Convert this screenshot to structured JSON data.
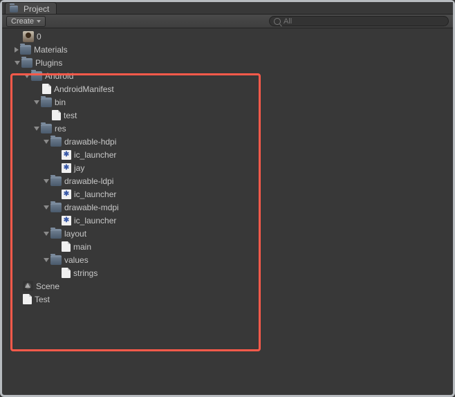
{
  "tab": {
    "title": "Project"
  },
  "toolbar": {
    "create_label": "Create",
    "search_placeholder": "All"
  },
  "tree": [
    {
      "depth": 0,
      "arrow": "none",
      "icon": "avatar",
      "label": "0"
    },
    {
      "depth": 0,
      "arrow": "collapsed",
      "icon": "folder",
      "label": "Materials"
    },
    {
      "depth": 0,
      "arrow": "expanded",
      "icon": "folder",
      "label": "Plugins"
    },
    {
      "depth": 1,
      "arrow": "expanded",
      "icon": "folder",
      "label": "Android"
    },
    {
      "depth": 2,
      "arrow": "none",
      "icon": "file",
      "label": "AndroidManifest"
    },
    {
      "depth": 2,
      "arrow": "expanded",
      "icon": "folder",
      "label": "bin"
    },
    {
      "depth": 3,
      "arrow": "none",
      "icon": "file",
      "label": "test"
    },
    {
      "depth": 2,
      "arrow": "expanded",
      "icon": "folder",
      "label": "res"
    },
    {
      "depth": 3,
      "arrow": "expanded",
      "icon": "folder",
      "label": "drawable-hdpi"
    },
    {
      "depth": 4,
      "arrow": "none",
      "icon": "img",
      "label": "ic_launcher"
    },
    {
      "depth": 4,
      "arrow": "none",
      "icon": "img",
      "label": "jay"
    },
    {
      "depth": 3,
      "arrow": "expanded",
      "icon": "folder",
      "label": "drawable-ldpi"
    },
    {
      "depth": 4,
      "arrow": "none",
      "icon": "img",
      "label": "ic_launcher"
    },
    {
      "depth": 3,
      "arrow": "expanded",
      "icon": "folder",
      "label": "drawable-mdpi"
    },
    {
      "depth": 4,
      "arrow": "none",
      "icon": "img",
      "label": "ic_launcher"
    },
    {
      "depth": 3,
      "arrow": "expanded",
      "icon": "folder",
      "label": "layout"
    },
    {
      "depth": 4,
      "arrow": "none",
      "icon": "file",
      "label": "main"
    },
    {
      "depth": 3,
      "arrow": "expanded",
      "icon": "folder",
      "label": "values"
    },
    {
      "depth": 4,
      "arrow": "none",
      "icon": "file",
      "label": "strings"
    },
    {
      "depth": 0,
      "arrow": "none",
      "icon": "unity",
      "label": "Scene"
    },
    {
      "depth": 0,
      "arrow": "none",
      "icon": "file",
      "label": "Test"
    }
  ]
}
